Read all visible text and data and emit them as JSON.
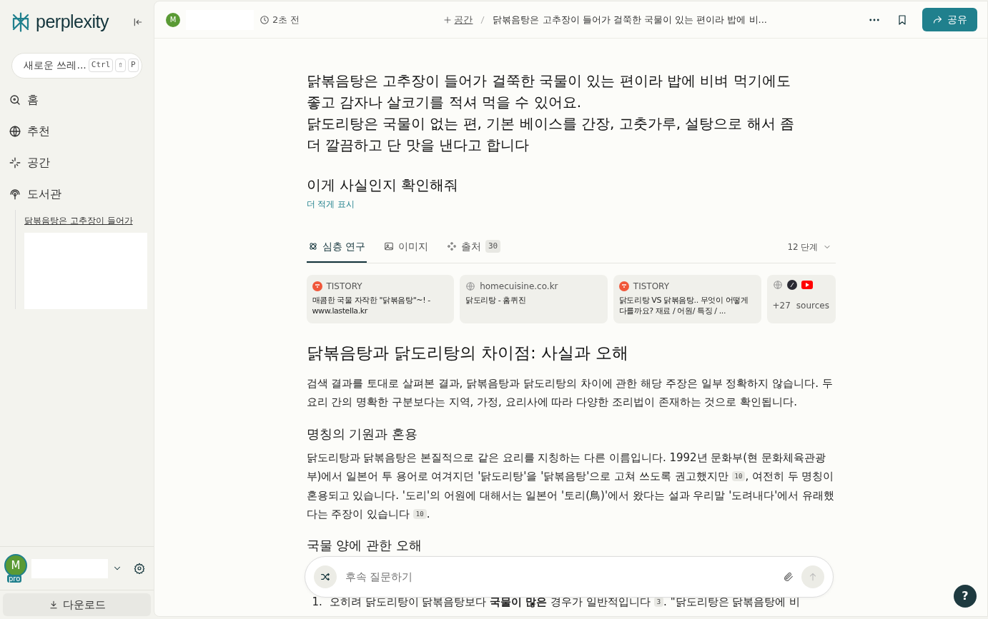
{
  "sidebar": {
    "brand": "perplexity",
    "new_thread": {
      "label": "새로운 쓰레...",
      "keys": [
        "Ctrl",
        "⇧",
        "P"
      ]
    },
    "nav": [
      {
        "label": "홈"
      },
      {
        "label": "추천"
      },
      {
        "label": "공간"
      },
      {
        "label": "도서관"
      }
    ],
    "history": [
      {
        "label": "닭볶음탕은 고추장이 들어가"
      }
    ],
    "user": {
      "initial": "M",
      "badge": "pro"
    },
    "download": "다운로드"
  },
  "topbar": {
    "avatar": "M",
    "time": "2초 전",
    "space": "공간",
    "title": "닭볶음탕은 고추장이 들어가 걸쭉한 국물이 있는 편이라 밥에 비...",
    "share": "공유"
  },
  "query": {
    "paragraphs": [
      "닭볶음탕은 고추장이 들어가 걸쭉한 국물이 있는 편이라 밥에 비벼 먹기에도 좋고 감자나 살코기를 적셔 먹을 수 있어요.",
      "닭도리탕은 국물이 없는 편, 기본 베이스를 간장, 고춧가루, 설탕으로 해서 좀 더 깔끔하고 단 맛을 낸다고 합니다"
    ],
    "ask": "이게 사실인지 확인해줘",
    "toggle": "더 적게 표시"
  },
  "tabs": [
    {
      "label": "심층 연구",
      "selected": true
    },
    {
      "label": "이미지",
      "selected": false
    },
    {
      "label": "출처",
      "count": "30",
      "selected": false
    }
  ],
  "steps": "12 단계",
  "sources": [
    {
      "kind": "tistory",
      "site": "TISTORY",
      "title": "매콤한 국물 자작한 \"닭볶음탕\"~! - www.lastella.kr"
    },
    {
      "kind": "web",
      "site": "homecuisine.co.kr",
      "title": "닭도리탕 - 홈퀴진"
    },
    {
      "kind": "tistory",
      "site": "TISTORY",
      "title": "닭도리탕 VS 닭볶음탕.. 무엇이 어떻게 다를까요? 재료 / 어원/ 특징 / ..."
    },
    {
      "kind": "more",
      "count": "+27",
      "label": "sources"
    }
  ],
  "answer": {
    "title": "닭볶음탕과 닭도리탕의 차이점: 사실과 오해",
    "sections": [
      {
        "parts": [
          {
            "kind": "text",
            "text": "검색 결과를 토대로 살펴본 결과, 닭볶음탕과 닭도리탕의 차이에 관한 해당 주장은 일부 정확하지 않습니다. 두 요리 간의 명확한 구분보다는 지역, 가정, 요리사에 따라 다양한 조리법이 존재하는 것으로 확인됩니다."
          }
        ]
      },
      {
        "heading": "명칭의 기원과 혼용",
        "parts": [
          {
            "kind": "text",
            "text": "닭도리탕과 닭볶음탕은 본질적으로 같은 요리를 지칭하는 다른 이름입니다. 1992년 문화부(현 문화체육관광부)에서 일본어 투 용어로 여겨지던 '닭도리탕'을 '닭볶음탕'으로 고쳐 쓰도록 권고했지만 "
          },
          {
            "kind": "cite",
            "text": "10"
          },
          {
            "kind": "text",
            "text": ", 여전히 두 명칭이 혼용되고 있습니다. '도리'의 어원에 대해서는 일본어 '토리(鳥)'에서 왔다는 설과 우리말 '도려내다'에서 유래했다는 주장이 있습니다 "
          },
          {
            "kind": "cite",
            "text": "10"
          },
          {
            "kind": "text",
            "text": "."
          }
        ]
      },
      {
        "heading": "국물 양에 관한 오해",
        "list": [
          {
            "marker": "1.",
            "parts": [
              {
                "kind": "text",
                "text": "오히려 닭도리탕이 닭볶음탕보다 **국물이 많은** 경우가 일반적입니다 "
              },
              {
                "kind": "cite",
                "text": "3"
              },
              {
                "kind": "text",
                "text": ". \"닭도리탕은 닭볶음탕에 비"
              }
            ]
          }
        ]
      }
    ]
  },
  "composer": {
    "placeholder": "후속 질문하기"
  },
  "help": "?"
}
